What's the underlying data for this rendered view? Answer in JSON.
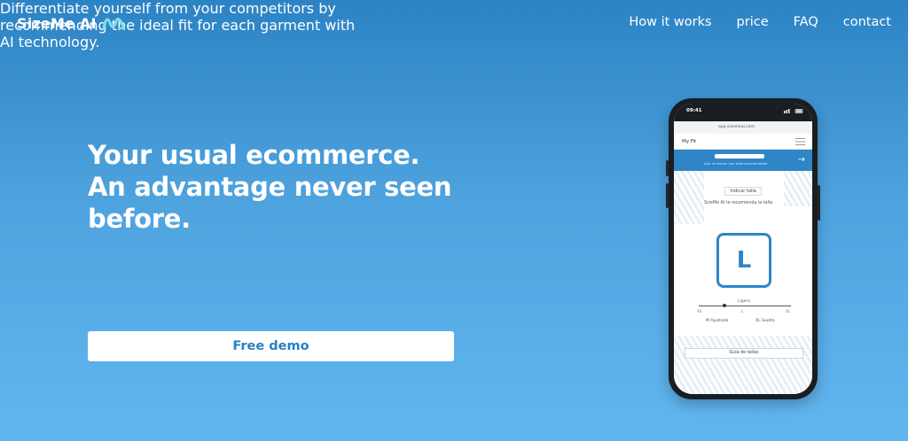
{
  "header": {
    "logo_text": "SizeMe AI",
    "logo_icon": "wave-logo-icon",
    "nav": [
      {
        "label": "How it works"
      },
      {
        "label": "price"
      },
      {
        "label": "FAQ"
      },
      {
        "label": "contact"
      }
    ]
  },
  "hero": {
    "headline_lines": [
      "Your usual ecommerce.",
      "An advantage never seen",
      "before."
    ],
    "subtext_lines": [
      "Differentiate yourself from your competitors by",
      "recommending the ideal fit for each garment with",
      "AI technology."
    ],
    "cta_label": "Free demo"
  },
  "phone": {
    "status_time": "09:41",
    "url": "app.sizemeai.com",
    "site_name": "My Fit",
    "banner_text": "Aún no tienes una talla recomendada",
    "preferences_label": "Indicar talla",
    "recommendation_text": "SizeMe AI te recomienda la talla",
    "recommended_size": "L",
    "slider_label": "Ligero",
    "slider_ticks": [
      "XS",
      "L",
      "XL"
    ],
    "alt_sizes": [
      "M Ajustado",
      "XL Suelto"
    ],
    "guide_label": "Guía de tallas"
  },
  "colors": {
    "accent": "#2f86c6",
    "background_top": "#2c83c4",
    "background_bottom": "#62b6f0"
  }
}
